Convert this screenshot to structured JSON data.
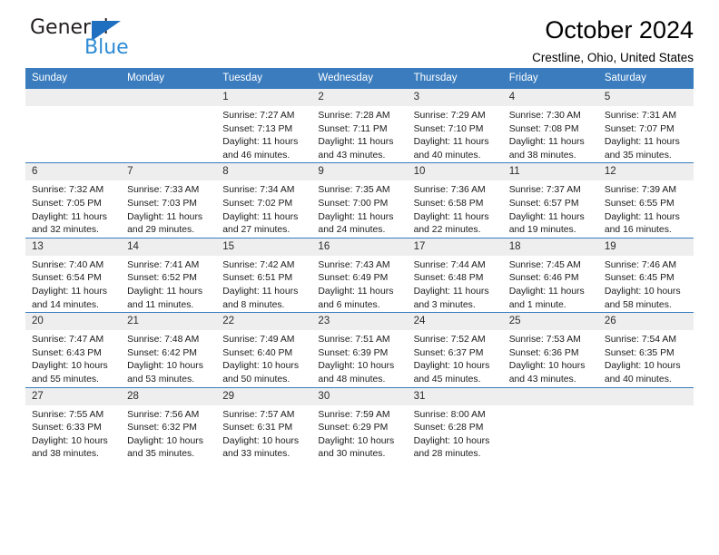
{
  "brand": {
    "name_primary": "General",
    "name_secondary": "Blue",
    "triangle_color": "#1f6fc0",
    "secondary_color": "#2e8bd4"
  },
  "header": {
    "title": "October 2024",
    "subtitle": "Crestline, Ohio, United States"
  },
  "theme": {
    "header_bg": "#3a7cbe",
    "daynum_bg": "#eeeeee",
    "cell_bg": "#ffffff",
    "text_color": "#1a1a1a"
  },
  "weekdays": [
    "Sunday",
    "Monday",
    "Tuesday",
    "Wednesday",
    "Thursday",
    "Friday",
    "Saturday"
  ],
  "weeks": [
    [
      {
        "day": "",
        "blank": true,
        "sunrise": "",
        "sunset": "",
        "daylight1": "",
        "daylight2": ""
      },
      {
        "day": "",
        "blank": true,
        "sunrise": "",
        "sunset": "",
        "daylight1": "",
        "daylight2": ""
      },
      {
        "day": "1",
        "sunrise": "Sunrise: 7:27 AM",
        "sunset": "Sunset: 7:13 PM",
        "daylight1": "Daylight: 11 hours",
        "daylight2": "and 46 minutes."
      },
      {
        "day": "2",
        "sunrise": "Sunrise: 7:28 AM",
        "sunset": "Sunset: 7:11 PM",
        "daylight1": "Daylight: 11 hours",
        "daylight2": "and 43 minutes."
      },
      {
        "day": "3",
        "sunrise": "Sunrise: 7:29 AM",
        "sunset": "Sunset: 7:10 PM",
        "daylight1": "Daylight: 11 hours",
        "daylight2": "and 40 minutes."
      },
      {
        "day": "4",
        "sunrise": "Sunrise: 7:30 AM",
        "sunset": "Sunset: 7:08 PM",
        "daylight1": "Daylight: 11 hours",
        "daylight2": "and 38 minutes."
      },
      {
        "day": "5",
        "sunrise": "Sunrise: 7:31 AM",
        "sunset": "Sunset: 7:07 PM",
        "daylight1": "Daylight: 11 hours",
        "daylight2": "and 35 minutes."
      }
    ],
    [
      {
        "day": "6",
        "sunrise": "Sunrise: 7:32 AM",
        "sunset": "Sunset: 7:05 PM",
        "daylight1": "Daylight: 11 hours",
        "daylight2": "and 32 minutes."
      },
      {
        "day": "7",
        "sunrise": "Sunrise: 7:33 AM",
        "sunset": "Sunset: 7:03 PM",
        "daylight1": "Daylight: 11 hours",
        "daylight2": "and 29 minutes."
      },
      {
        "day": "8",
        "sunrise": "Sunrise: 7:34 AM",
        "sunset": "Sunset: 7:02 PM",
        "daylight1": "Daylight: 11 hours",
        "daylight2": "and 27 minutes."
      },
      {
        "day": "9",
        "sunrise": "Sunrise: 7:35 AM",
        "sunset": "Sunset: 7:00 PM",
        "daylight1": "Daylight: 11 hours",
        "daylight2": "and 24 minutes."
      },
      {
        "day": "10",
        "sunrise": "Sunrise: 7:36 AM",
        "sunset": "Sunset: 6:58 PM",
        "daylight1": "Daylight: 11 hours",
        "daylight2": "and 22 minutes."
      },
      {
        "day": "11",
        "sunrise": "Sunrise: 7:37 AM",
        "sunset": "Sunset: 6:57 PM",
        "daylight1": "Daylight: 11 hours",
        "daylight2": "and 19 minutes."
      },
      {
        "day": "12",
        "sunrise": "Sunrise: 7:39 AM",
        "sunset": "Sunset: 6:55 PM",
        "daylight1": "Daylight: 11 hours",
        "daylight2": "and 16 minutes."
      }
    ],
    [
      {
        "day": "13",
        "sunrise": "Sunrise: 7:40 AM",
        "sunset": "Sunset: 6:54 PM",
        "daylight1": "Daylight: 11 hours",
        "daylight2": "and 14 minutes."
      },
      {
        "day": "14",
        "sunrise": "Sunrise: 7:41 AM",
        "sunset": "Sunset: 6:52 PM",
        "daylight1": "Daylight: 11 hours",
        "daylight2": "and 11 minutes."
      },
      {
        "day": "15",
        "sunrise": "Sunrise: 7:42 AM",
        "sunset": "Sunset: 6:51 PM",
        "daylight1": "Daylight: 11 hours",
        "daylight2": "and 8 minutes."
      },
      {
        "day": "16",
        "sunrise": "Sunrise: 7:43 AM",
        "sunset": "Sunset: 6:49 PM",
        "daylight1": "Daylight: 11 hours",
        "daylight2": "and 6 minutes."
      },
      {
        "day": "17",
        "sunrise": "Sunrise: 7:44 AM",
        "sunset": "Sunset: 6:48 PM",
        "daylight1": "Daylight: 11 hours",
        "daylight2": "and 3 minutes."
      },
      {
        "day": "18",
        "sunrise": "Sunrise: 7:45 AM",
        "sunset": "Sunset: 6:46 PM",
        "daylight1": "Daylight: 11 hours",
        "daylight2": "and 1 minute."
      },
      {
        "day": "19",
        "sunrise": "Sunrise: 7:46 AM",
        "sunset": "Sunset: 6:45 PM",
        "daylight1": "Daylight: 10 hours",
        "daylight2": "and 58 minutes."
      }
    ],
    [
      {
        "day": "20",
        "sunrise": "Sunrise: 7:47 AM",
        "sunset": "Sunset: 6:43 PM",
        "daylight1": "Daylight: 10 hours",
        "daylight2": "and 55 minutes."
      },
      {
        "day": "21",
        "sunrise": "Sunrise: 7:48 AM",
        "sunset": "Sunset: 6:42 PM",
        "daylight1": "Daylight: 10 hours",
        "daylight2": "and 53 minutes."
      },
      {
        "day": "22",
        "sunrise": "Sunrise: 7:49 AM",
        "sunset": "Sunset: 6:40 PM",
        "daylight1": "Daylight: 10 hours",
        "daylight2": "and 50 minutes."
      },
      {
        "day": "23",
        "sunrise": "Sunrise: 7:51 AM",
        "sunset": "Sunset: 6:39 PM",
        "daylight1": "Daylight: 10 hours",
        "daylight2": "and 48 minutes."
      },
      {
        "day": "24",
        "sunrise": "Sunrise: 7:52 AM",
        "sunset": "Sunset: 6:37 PM",
        "daylight1": "Daylight: 10 hours",
        "daylight2": "and 45 minutes."
      },
      {
        "day": "25",
        "sunrise": "Sunrise: 7:53 AM",
        "sunset": "Sunset: 6:36 PM",
        "daylight1": "Daylight: 10 hours",
        "daylight2": "and 43 minutes."
      },
      {
        "day": "26",
        "sunrise": "Sunrise: 7:54 AM",
        "sunset": "Sunset: 6:35 PM",
        "daylight1": "Daylight: 10 hours",
        "daylight2": "and 40 minutes."
      }
    ],
    [
      {
        "day": "27",
        "sunrise": "Sunrise: 7:55 AM",
        "sunset": "Sunset: 6:33 PM",
        "daylight1": "Daylight: 10 hours",
        "daylight2": "and 38 minutes."
      },
      {
        "day": "28",
        "sunrise": "Sunrise: 7:56 AM",
        "sunset": "Sunset: 6:32 PM",
        "daylight1": "Daylight: 10 hours",
        "daylight2": "and 35 minutes."
      },
      {
        "day": "29",
        "sunrise": "Sunrise: 7:57 AM",
        "sunset": "Sunset: 6:31 PM",
        "daylight1": "Daylight: 10 hours",
        "daylight2": "and 33 minutes."
      },
      {
        "day": "30",
        "sunrise": "Sunrise: 7:59 AM",
        "sunset": "Sunset: 6:29 PM",
        "daylight1": "Daylight: 10 hours",
        "daylight2": "and 30 minutes."
      },
      {
        "day": "31",
        "sunrise": "Sunrise: 8:00 AM",
        "sunset": "Sunset: 6:28 PM",
        "daylight1": "Daylight: 10 hours",
        "daylight2": "and 28 minutes."
      },
      {
        "day": "",
        "blank": true,
        "sunrise": "",
        "sunset": "",
        "daylight1": "",
        "daylight2": ""
      },
      {
        "day": "",
        "blank": true,
        "sunrise": "",
        "sunset": "",
        "daylight1": "",
        "daylight2": ""
      }
    ]
  ]
}
